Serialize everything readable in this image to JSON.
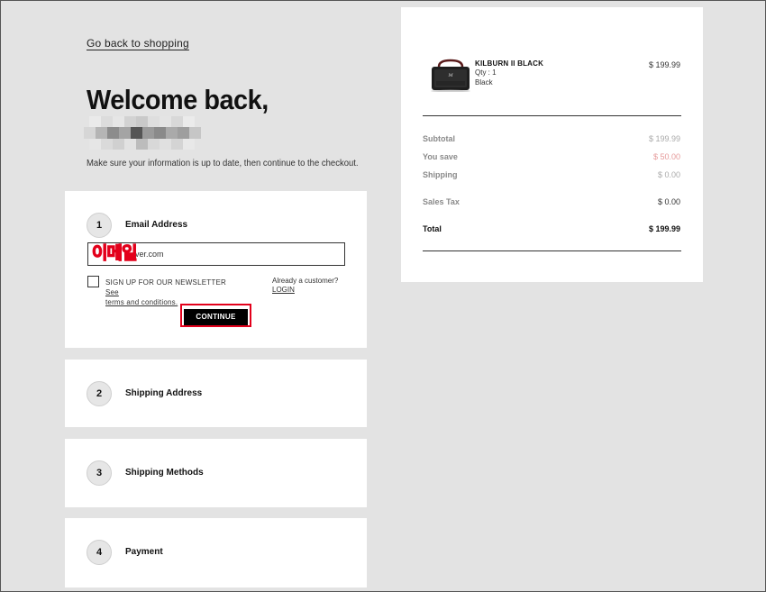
{
  "nav": {
    "back_link": "Go back to shopping"
  },
  "header": {
    "welcome": "Welcome back,",
    "intro": "Make sure your information is up to date, then continue to the checkout."
  },
  "steps": {
    "email": {
      "number": "1",
      "title": "Email Address",
      "input_value": "ver.com",
      "overlay_label": "이메일",
      "newsletter_prefix": "SIGN UP FOR OUR NEWSLETTER",
      "newsletter_see": "See",
      "newsletter_terms": "terms and conditions.",
      "already_customer": "Already a customer?",
      "login": "LOGIN",
      "continue_label": "CONTINUE"
    },
    "shipping": {
      "number": "2",
      "title": "Shipping Address"
    },
    "methods": {
      "number": "3",
      "title": "Shipping Methods"
    },
    "payment": {
      "number": "4",
      "title": "Payment"
    }
  },
  "summary": {
    "product": {
      "name": "KILBURN II BLACK",
      "qty": "Qty : 1",
      "color": "Black",
      "price": "$ 199.99",
      "icon": "speaker-product-image"
    },
    "subtotal_label": "Subtotal",
    "subtotal_value": "$ 199.99",
    "save_label": "You save",
    "save_value": "$ 50.00",
    "shipping_label": "Shipping",
    "shipping_value": "$ 0.00",
    "tax_label": "Sales Tax",
    "tax_value": "$ 0.00",
    "total_label": "Total",
    "total_value": "$ 199.99"
  },
  "colors": {
    "accent_red": "#e3001b",
    "background": "#e3e3e3",
    "button": "#000000"
  }
}
